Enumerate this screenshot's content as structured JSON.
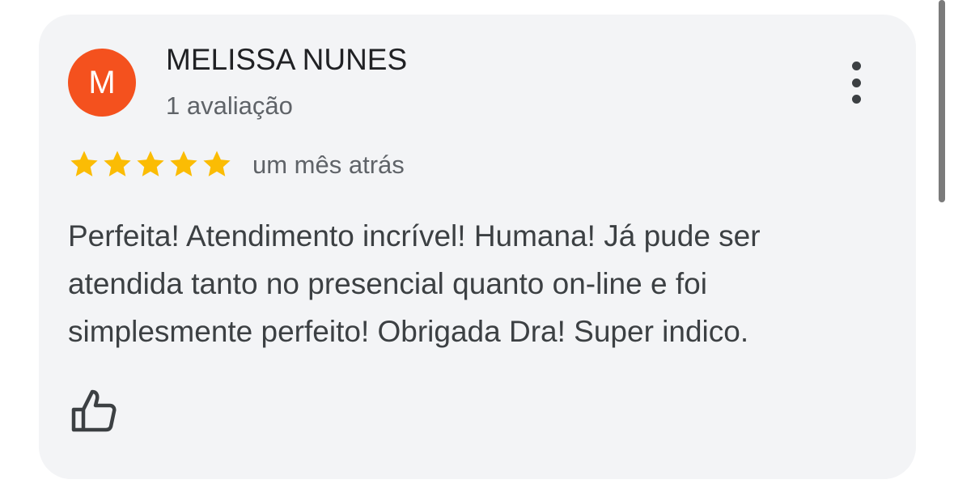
{
  "review": {
    "avatar_initial": "M",
    "avatar_color": "#f4511e",
    "reviewer_name": "MELISSA NUNES",
    "review_count": "1 avaliação",
    "rating": 5,
    "rating_max": 5,
    "star_color": "#fbbc04",
    "time_ago": "um mês atrás",
    "text": "Perfeita! Atendimento incrível! Humana! Já pude ser atendida tanto no presencial quanto on-line e foi simplesmente perfeito! Obrigada Dra! Super indico.",
    "more_icon": "more-vert-icon",
    "like_icon": "thumb-up-icon"
  }
}
